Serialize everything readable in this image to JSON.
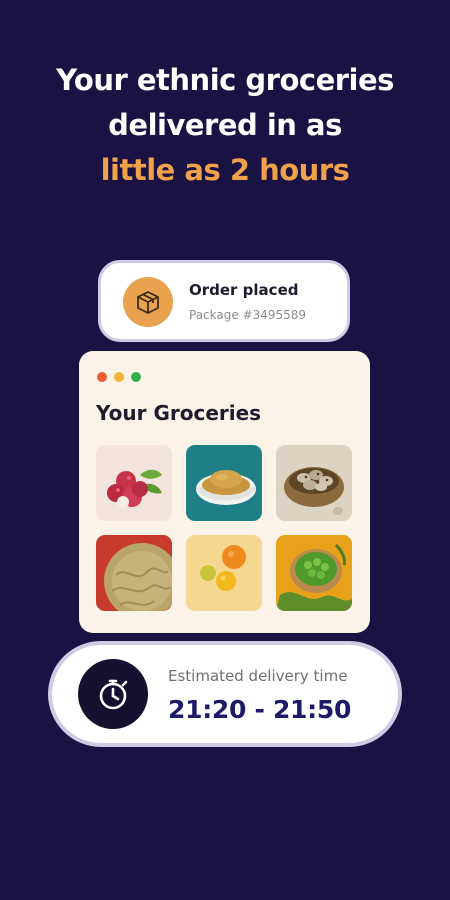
{
  "headline": {
    "line1": "Your ethnic groceries",
    "line2": "delivered in as",
    "line3_accent": "little as 2 hours"
  },
  "order": {
    "title": "Order placed",
    "package": "Package #3495589",
    "icon": "package-box-icon"
  },
  "groceries": {
    "title": "Your Groceries",
    "window_dots": [
      "#ec5a36",
      "#f2b33a",
      "#33b04a"
    ],
    "items": [
      {
        "name": "lychees"
      },
      {
        "name": "ground-spice"
      },
      {
        "name": "quail-eggs"
      },
      {
        "name": "vermicelli"
      },
      {
        "name": "citrus-fruits"
      },
      {
        "name": "green-peas"
      }
    ]
  },
  "delivery": {
    "label": "Estimated delivery time",
    "time": "21:20 - 21:50",
    "icon": "stopwatch-icon"
  },
  "colors": {
    "background": "#191243",
    "accent": "#f0a24a",
    "time_text": "#1d1a6a"
  }
}
